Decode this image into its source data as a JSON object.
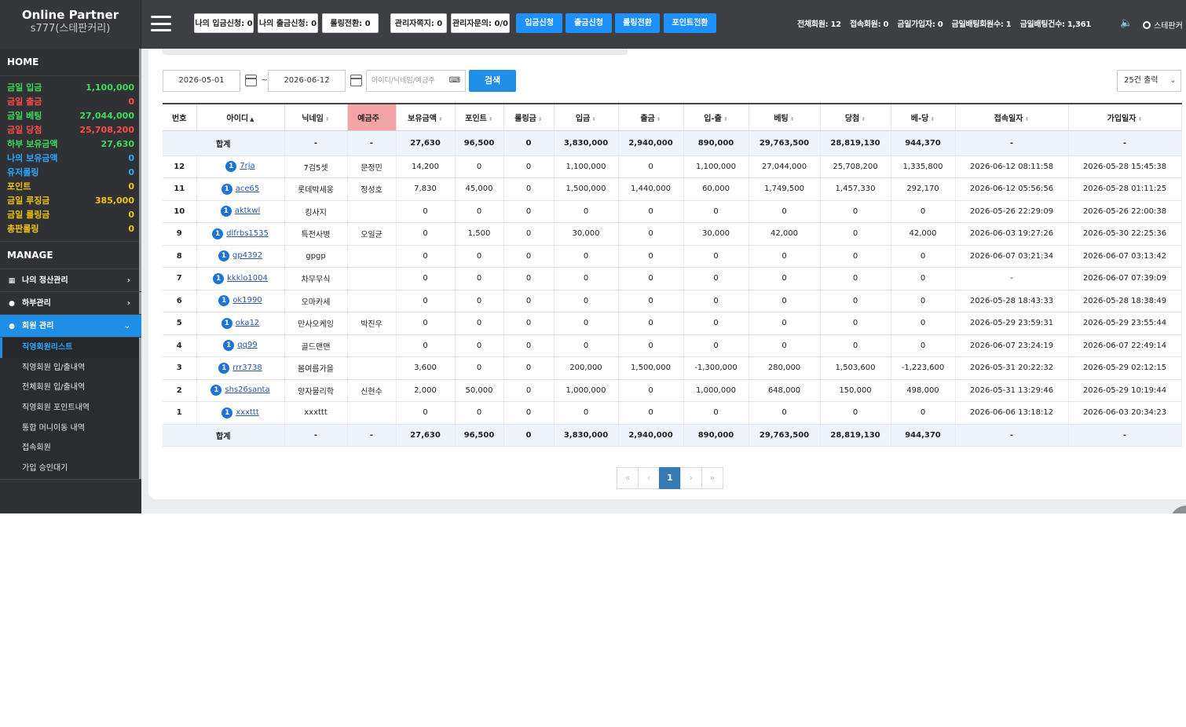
{
  "brand": {
    "title": "Online Partner",
    "subtitle": "s777(스테판커리)"
  },
  "topbar": {
    "buttons": [
      {
        "label": "나의 입금신청: 0",
        "style": "white"
      },
      {
        "label": "나의 출금신청: 0",
        "style": "white"
      },
      {
        "label": "롤링전환: 0",
        "style": "white"
      },
      {
        "label": "관리자쪽지: 0",
        "style": "white"
      },
      {
        "label": "관리자문의: 0/0",
        "style": "white"
      },
      {
        "label": "입금신청",
        "style": "blue"
      },
      {
        "label": "출금신청",
        "style": "blue"
      },
      {
        "label": "롤링전환",
        "style": "blue"
      },
      {
        "label": "포인트전환",
        "style": "blue"
      }
    ],
    "stats": [
      "전체회원: 12",
      "접속회원: 0",
      "금일가입자: 0",
      "금일배팅회원수: 1",
      "금일배팅건수: 1,361"
    ],
    "user": "스테판커"
  },
  "sidebar": {
    "home": "HOME",
    "summary": [
      {
        "label": "금일 입금",
        "value": "1,100,000",
        "color": "#3ddc5a"
      },
      {
        "label": "금일 출금",
        "value": "0",
        "color": "#ff4b4b"
      },
      {
        "label": "금일 베팅",
        "value": "27,044,000",
        "color": "#3ddc5a"
      },
      {
        "label": "금일 당첨",
        "value": "25,708,200",
        "color": "#ff4b4b"
      },
      {
        "label": "하부 보유금액",
        "value": "27,630",
        "color": "#3ddc5a"
      },
      {
        "label": "나의 보유금액",
        "value": "0",
        "color": "#29a9ff"
      },
      {
        "label": "유저롤링",
        "value": "0",
        "color": "#29a9ff"
      },
      {
        "label": "포인트",
        "value": "0",
        "color": "#f1c40f"
      },
      {
        "label": "금일 루징금",
        "value": "385,000",
        "color": "#f1c40f"
      },
      {
        "label": "금일 롤링금",
        "value": "0",
        "color": "#f1c40f"
      },
      {
        "label": "총판롤링",
        "value": "0",
        "color": "#f1c40f"
      }
    ],
    "manage": "MANAGE",
    "menu": [
      {
        "label": "나의 정산관리",
        "icon": "calculator-icon"
      },
      {
        "label": "하부관리",
        "icon": "user-icon"
      },
      {
        "label": "회원 관리",
        "icon": "user-icon"
      }
    ],
    "submenu": [
      "직영회원리스트",
      "직영회원 입/출내역",
      "전체회원 입/출내역",
      "직영회원 포인트내역",
      "통합 머니이동 내역",
      "접속회원",
      "가입 승인대기"
    ]
  },
  "filters": {
    "date_from": "2026-05-01",
    "date_to": "2026-06-12",
    "search_placeholder": "아이디/닉네임/예금주",
    "search_button": "검색",
    "per_page": "25건 출력"
  },
  "table": {
    "headers": [
      "번호",
      "아이디",
      "닉네임",
      "예금주",
      "보유금액",
      "포인트",
      "롤링금",
      "입금",
      "출금",
      "입-출",
      "베팅",
      "당첨",
      "베-당",
      "접속일자",
      "가입일자"
    ],
    "total_label": "합계",
    "totals": [
      "합계",
      "",
      "-",
      "-",
      "27,630",
      "96,500",
      "0",
      "3,830,000",
      "2,940,000",
      "890,000",
      "29,763,500",
      "28,819,130",
      "944,370",
      "-",
      "-"
    ],
    "rows": [
      [
        "12",
        "7rja",
        "7검5셋",
        "문정민",
        "14,200",
        "0",
        "0",
        "1,100,000",
        "0",
        "1,100,000",
        "27,044,000",
        "25,708,200",
        "1,335,800",
        "2026-06-12 08:11:58",
        "2026-05-28 15:45:38"
      ],
      [
        "11",
        "ace65",
        "롯데박세웅",
        "정성호",
        "7,830",
        "45,000",
        "0",
        "1,500,000",
        "1,440,000",
        "60,000",
        "1,749,500",
        "1,457,330",
        "292,170",
        "2026-06-12 05:56:56",
        "2026-05-28 01:11:25"
      ],
      [
        "10",
        "aktkwl",
        "킹사지",
        "",
        "0",
        "0",
        "0",
        "0",
        "0",
        "0",
        "0",
        "0",
        "0",
        "2026-05-26 22:29:09",
        "2026-05-26 22:00:38"
      ],
      [
        "9",
        "dlfrbs1535",
        "특전사병",
        "오일균",
        "0",
        "1,500",
        "0",
        "30,000",
        "0",
        "30,000",
        "42,000",
        "0",
        "42,000",
        "2026-06-03 19:27:26",
        "2026-05-30 22:25:36"
      ],
      [
        "8",
        "gp4392",
        "gpgp",
        "",
        "0",
        "0",
        "0",
        "0",
        "0",
        "0",
        "0",
        "0",
        "0",
        "2026-06-07 03:21:34",
        "2026-06-07 03:13:42"
      ],
      [
        "7",
        "kkklo1004",
        "차무무식",
        "",
        "0",
        "0",
        "0",
        "0",
        "0",
        "0",
        "0",
        "0",
        "0",
        "-",
        "2026-06-07 07:39:09"
      ],
      [
        "6",
        "ok1990",
        "오마카세",
        "",
        "0",
        "0",
        "0",
        "0",
        "0",
        "0",
        "0",
        "0",
        "0",
        "2026-05-28 18:43:33",
        "2026-05-28 18:38:49"
      ],
      [
        "5",
        "oka12",
        "만사오케잉",
        "박진우",
        "0",
        "0",
        "0",
        "0",
        "0",
        "0",
        "0",
        "0",
        "0",
        "2026-05-29 23:59:31",
        "2026-05-29 23:55:44"
      ],
      [
        "4",
        "qq99",
        "골드맨맨",
        "",
        "0",
        "0",
        "0",
        "0",
        "0",
        "0",
        "0",
        "0",
        "0",
        "2026-06-07 23:24:19",
        "2026-06-07 22:49:14"
      ],
      [
        "3",
        "rrr3738",
        "봄여름가을",
        "",
        "3,600",
        "0",
        "0",
        "200,000",
        "1,500,000",
        "-1,300,000",
        "280,000",
        "1,503,600",
        "-1,223,600",
        "2026-05-31 20:22:32",
        "2026-05-29 02:12:15"
      ],
      [
        "2",
        "shs26santa",
        "양자물리학",
        "신현수",
        "2,000",
        "50,000",
        "0",
        "1,000,000",
        "0",
        "1,000,000",
        "648,000",
        "150,000",
        "498,000",
        "2026-05-31 13:29:46",
        "2026-05-29 10:19:44"
      ],
      [
        "1",
        "xxxttt",
        "xxxttt",
        "",
        "0",
        "0",
        "0",
        "0",
        "0",
        "0",
        "0",
        "0",
        "0",
        "2026-06-06 13:18:12",
        "2026-06-03 20:34:23"
      ]
    ],
    "id_badge": "1"
  },
  "pagination": {
    "first": "«",
    "prev": "‹",
    "current": "1",
    "next": "›",
    "last": "»"
  }
}
